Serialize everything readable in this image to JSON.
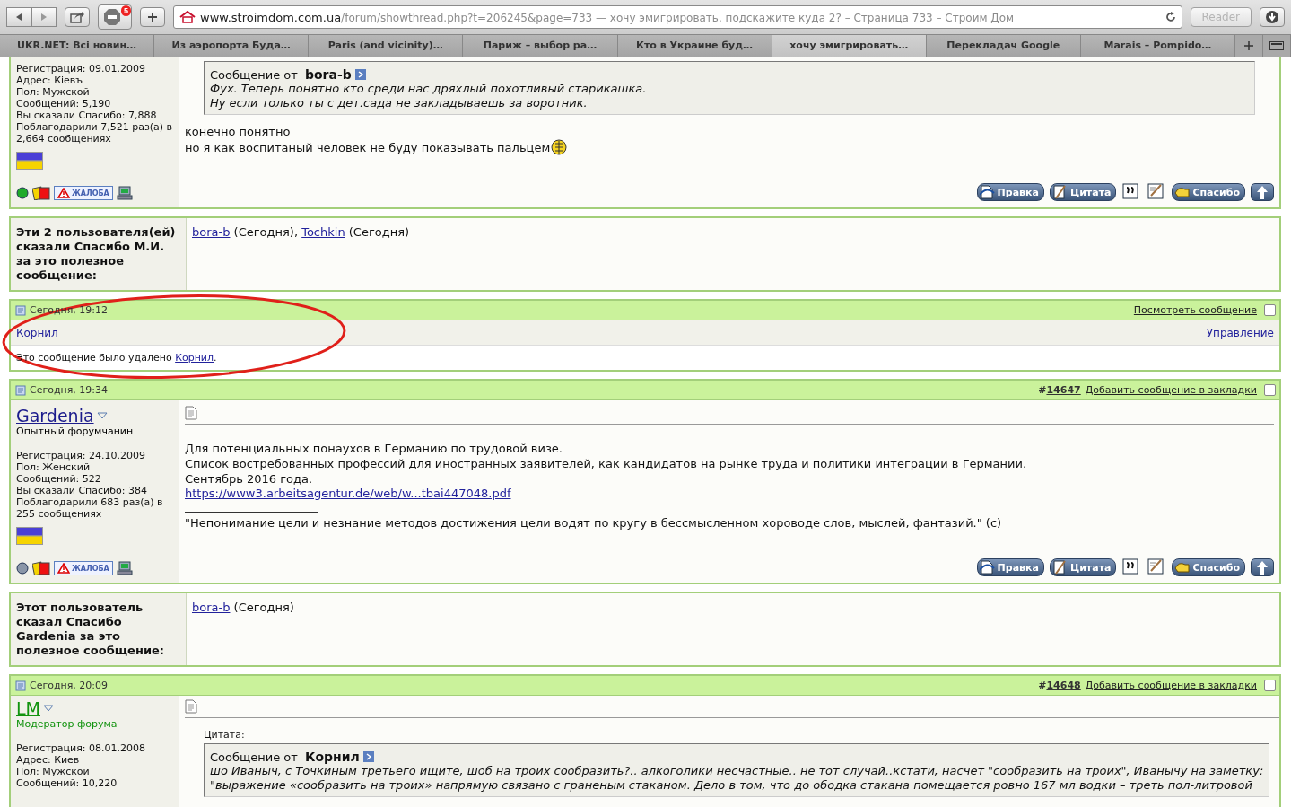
{
  "toolbar": {
    "adblock_count": "5",
    "url_host": "www.stroimdom.com.ua",
    "url_rest": "/forum/showthread.php?t=206245&page=733 — хочу эмигрировать. подскажите куда 2? – Страница 733 – Строим Дом",
    "reader": "Reader"
  },
  "tabs": [
    {
      "label": "UKR.NET: Всі новин…",
      "selected": false
    },
    {
      "label": "Из аэропорта Буда…",
      "selected": false
    },
    {
      "label": "Paris (and vicinity)…",
      "selected": false
    },
    {
      "label": "Париж – выбор ра…",
      "selected": false
    },
    {
      "label": "Кто в Украине буд…",
      "selected": false
    },
    {
      "label": "хочу эмигрировать…",
      "selected": true
    },
    {
      "label": "Перекладач Google",
      "selected": false
    },
    {
      "label": "Marais – Pompido…",
      "selected": false
    }
  ],
  "posts": [
    {
      "kind": "post",
      "cut_top": true,
      "info": [
        "Регистрация: 09.01.2009",
        "Адрес: Кiевъ",
        "Пол: Мужской",
        "Сообщений: 5,190",
        "Вы сказали Спасибо: 7,888",
        "Поблагодарили 7,521 раз(а) в 2,664 сообщениях"
      ],
      "online": true,
      "report": "ЖАЛОБА",
      "quote": {
        "from": "Сообщение от ",
        "author": "bora-b",
        "lines": [
          "Фух. Теперь понятно кто среди нас дряхлый похотливый старикашка.",
          "Ну если только ты с дет.сада не закладываешь за воротник."
        ]
      },
      "body": [
        {
          "kind": "text",
          "text": "конечно понятно"
        },
        {
          "kind": "text",
          "text": "но я как воспитаный человек не буду показывать пальцем",
          "smiley": true
        }
      ],
      "buttons": [
        {
          "kind": "edit",
          "label": "Правка"
        },
        {
          "kind": "quote",
          "label": "Цитата"
        },
        {
          "kind": "multiquote"
        },
        {
          "kind": "reply"
        },
        {
          "kind": "thanks",
          "label": "Спасибо"
        },
        {
          "kind": "top"
        }
      ]
    },
    {
      "kind": "thanks",
      "label": "Эти 2 пользователя(ей) сказали Спасибо М.И. за это полезное сообщение:",
      "users": [
        {
          "name": "bora-b",
          "after": "(Сегодня),"
        },
        {
          "name": "Tochkin",
          "after": "(Сегодня)"
        }
      ]
    },
    {
      "kind": "deleted",
      "circled": true,
      "date": "Сегодня, 19:12",
      "view": "Посмотреть сообщение",
      "checked": false,
      "username": "Корнил",
      "manage": "Управление",
      "note": "Это сообщение было удалено ",
      "note_user": "Корнил",
      "note_end": "."
    },
    {
      "kind": "post",
      "date": "Сегодня, 19:34",
      "hash": "#",
      "number": "14647",
      "bookmark": "Добавить сообщение в закладки",
      "checked": false,
      "username": "Gardenia",
      "color": "#1c1c8c",
      "user_title": {
        "text": "Опытный форумчанин",
        "color": "#000000"
      },
      "info": [
        "Регистрация: 24.10.2009",
        "Пол: Женский",
        "Сообщений: 522",
        "Вы сказали Спасибо: 384",
        "Поблагодарили 683 раз(а) в 255 сообщениях"
      ],
      "online": false,
      "report": "ЖАЛОБА",
      "body": [
        {
          "kind": "text",
          "text": "Для потенциальных понаухов в Германию по трудовой визе."
        },
        {
          "kind": "text",
          "text": "Список востребованных профессий для иностранных заявителей, как кандидатов на рынке труда и политики интеграции в Германии."
        },
        {
          "kind": "text",
          "text": "Сентябрь 2016 года."
        },
        {
          "kind": "link",
          "text": "https://www3.arbeitsagentur.de/web/w...tbai447048.pdf"
        },
        {
          "kind": "rule"
        },
        {
          "kind": "text",
          "text": "\"Непонимание цели и незнание методов достижения цели водят по кругу в бессмысленном хороводе слов, мыслей, фантазий.\" (с)"
        }
      ],
      "buttons": [
        {
          "kind": "edit",
          "label": "Правка"
        },
        {
          "kind": "quote",
          "label": "Цитата"
        },
        {
          "kind": "multiquote"
        },
        {
          "kind": "reply"
        },
        {
          "kind": "thanks",
          "label": "Спасибо"
        },
        {
          "kind": "top"
        }
      ]
    },
    {
      "kind": "thanks",
      "label": "Этот пользователь сказал Спасибо Gardenia за это полезное сообщение:",
      "users": [
        {
          "name": "bora-b",
          "after": "(Сегодня)"
        }
      ]
    },
    {
      "kind": "post",
      "date": "Сегодня, 20:09",
      "hash": "#",
      "number": "14648",
      "bookmark": "Добавить сообщение в закладки",
      "checked": false,
      "username": "LM",
      "color": "#12930f",
      "user_title": {
        "text": "Модератор форума",
        "color": "#12930f"
      },
      "info": [
        "Регистрация: 08.01.2008",
        "Адрес: Киев",
        "Пол: Мужской",
        "Сообщений: 10,220"
      ],
      "quote_label": "Цитата:",
      "quote": {
        "from": "Сообщение от ",
        "author": "Корнил",
        "lines": [
          "шо Иваныч, с Точкиным третьего ищите, шоб на троих сообразить?.. алкоголики несчастные.. не тот случай..кстати, насчет \"сообразить на троих\", Иванычу на заметку:",
          "\"выражение «сообразить на троих» напрямую связано с граненым стаканом. Дело в том, что до ободка стакана помещается ровно 167 мл водки – треть пол-литровой"
        ]
      }
    }
  ]
}
